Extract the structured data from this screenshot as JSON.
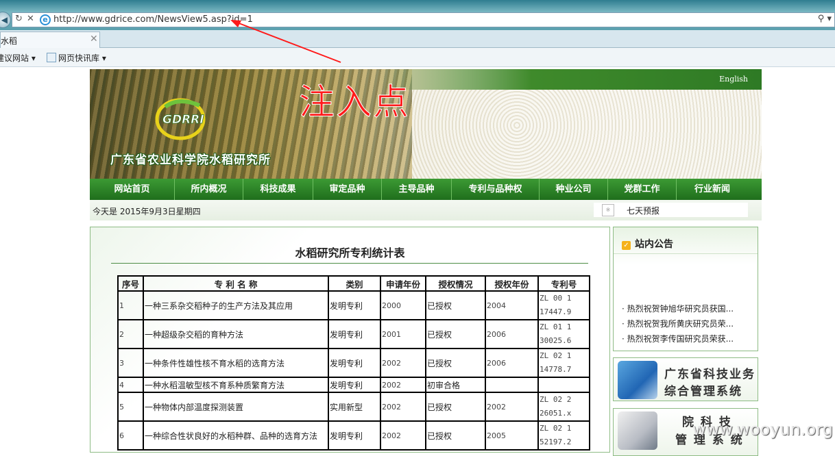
{
  "browser": {
    "url": "http://www.gdrice.com/NewsView5.asp?id=1",
    "tab_title": "水稻",
    "favorites": [
      "建议网站",
      "网页快讯库"
    ],
    "search_glyph": "⚲",
    "dropdown_glyph": "▾"
  },
  "annotation": {
    "injection_label": "注入点",
    "arrow_color": "#ff1a1a"
  },
  "site": {
    "english_link": "English",
    "org_name": "广东省农业科学院水稻研究所",
    "logo_text": "GDRRI",
    "menu": [
      "网站首页",
      "所内概况",
      "科技成果",
      "审定品种",
      "主导品种",
      "专利与品种权",
      "种业公司",
      "党群工作",
      "行业新闻"
    ],
    "date_text": "今天是 2015年9月3日星期四",
    "weather_label": "七天预报",
    "weather_img_glyph": "※"
  },
  "patent_table": {
    "title": "水稻研究所专利统计表",
    "headers": [
      "序号",
      "专 利 名 称",
      "类别",
      "申请年份",
      "授权情况",
      "授权年份",
      "专利号"
    ],
    "rows": [
      {
        "no": "1",
        "name": "一种三系杂交稻种子的生产方法及其应用",
        "type": "发明专利",
        "apply": "2000",
        "status": "已授权",
        "grant": "2004",
        "id1": "ZL 00 1",
        "id2": "17447.9"
      },
      {
        "no": "2",
        "name": "一种超级杂交稻的育种方法",
        "type": "发明专利",
        "apply": "2001",
        "status": "已授权",
        "grant": "2006",
        "id1": "ZL 01 1",
        "id2": "30025.6"
      },
      {
        "no": "3",
        "name": "一种条件性雄性核不育水稻的选育方法",
        "type": "发明专利",
        "apply": "2002",
        "status": "已授权",
        "grant": "2006",
        "id1": "ZL 02 1",
        "id2": "14778.7"
      },
      {
        "no": "4",
        "name": "一种水稻温敏型核不育系种质繁育方法",
        "type": "发明专利",
        "apply": "2002",
        "status": "初审合格",
        "grant": "",
        "id1": "",
        "id2": ""
      },
      {
        "no": "5",
        "name": "一种物体内部温度探测装置",
        "type": "实用新型",
        "apply": "2002",
        "status": "已授权",
        "grant": "2002",
        "id1": "ZL 02 2",
        "id2": "26051.x"
      },
      {
        "no": "6",
        "name": "一种综合性状良好的水稻种群、品种的选育方法",
        "type": "发明专利",
        "apply": "2002",
        "status": "已授权",
        "grant": "2005",
        "id1": "ZL 02 1",
        "id2": "52197.2"
      }
    ]
  },
  "notice": {
    "title": "站内公告",
    "icon_glyph": "✓",
    "items": [
      "· 热烈祝贺钟旭华研究员获国...",
      "· 热烈祝贺我所黄庆研究员荣...",
      "· 热烈祝贺李传国研究员荣获..."
    ]
  },
  "promos": [
    {
      "line1": "广东省科技业务",
      "line2": "综合管理系统"
    },
    {
      "line1": "院 科 技",
      "line2": "管 理 系 统"
    }
  ],
  "watermark": "www.wooyun.org"
}
